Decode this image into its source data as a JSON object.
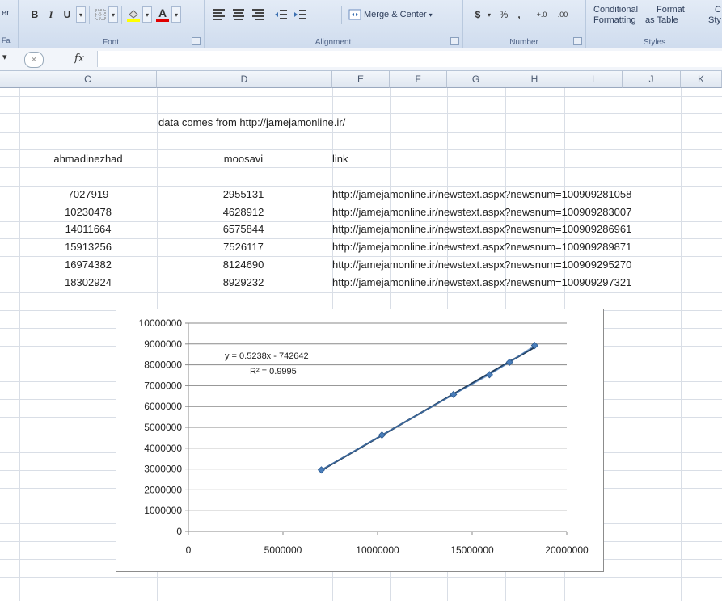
{
  "ribbon": {
    "font_group_label": "Font",
    "bold_label": "B",
    "italic_label": "I",
    "underline_label": "U",
    "font_color_label": "A",
    "alignment_group_label": "Alignment",
    "merge_center_label": "Merge & Center",
    "number_group_label": "Number",
    "currency_label": "$",
    "percent_label": "%",
    "comma_label": ",",
    "increase_decimal_label": "+.0",
    "decrease_decimal_label": ".00",
    "conditional_formatting_label_1": "Conditional",
    "conditional_formatting_label_2": "Formatting",
    "format_table_label_1": "Format",
    "format_table_label_2": "as Table",
    "cell_styles_label_1": "C",
    "cell_styles_label_2": "Sty",
    "styles_group_label": "Styles",
    "left_clip_1": "er",
    "left_clip_2": "Fa"
  },
  "formula_bar": {
    "fx_label": "fx"
  },
  "grid": {
    "columns": [
      "C",
      "D",
      "E",
      "F",
      "G",
      "H",
      "I",
      "J",
      "K"
    ],
    "source_note": "data comes from http://jamejamonline.ir/",
    "headers": {
      "c": "ahmadinezhad",
      "d": "moosavi",
      "e": "link"
    },
    "rows": [
      {
        "c": "7027919",
        "d": "2955131",
        "link": "http://jamejamonline.ir/newstext.aspx?newsnum=100909281058"
      },
      {
        "c": "10230478",
        "d": "4628912",
        "link": "http://jamejamonline.ir/newstext.aspx?newsnum=100909283007"
      },
      {
        "c": "14011664",
        "d": "6575844",
        "link": "http://jamejamonline.ir/newstext.aspx?newsnum=100909286961"
      },
      {
        "c": "15913256",
        "d": "7526117",
        "link": "http://jamejamonline.ir/newstext.aspx?newsnum=100909289871"
      },
      {
        "c": "16974382",
        "d": "8124690",
        "link": "http://jamejamonline.ir/newstext.aspx?newsnum=100909295270"
      },
      {
        "c": "18302924",
        "d": "8929232",
        "link": "http://jamejamonline.ir/newstext.aspx?newsnum=100909297321"
      }
    ]
  },
  "chart_data": {
    "type": "scatter",
    "x": [
      7027919,
      10230478,
      14011664,
      15913256,
      16974382,
      18302924
    ],
    "y": [
      2955131,
      4628912,
      6575844,
      7526117,
      8124690,
      8929232
    ],
    "xlim": [
      0,
      20000000
    ],
    "ylim": [
      0,
      10000000
    ],
    "x_ticks": [
      0,
      5000000,
      10000000,
      15000000,
      20000000
    ],
    "y_ticks": [
      0,
      1000000,
      2000000,
      3000000,
      4000000,
      5000000,
      6000000,
      7000000,
      8000000,
      9000000,
      10000000
    ],
    "grid": "horizontal",
    "trendline": {
      "slope": 0.5238,
      "intercept": -742642
    },
    "equation_label": "y = 0.5238x - 742642",
    "r2_label": "R² = 0.9995",
    "marker_color": "#4a7ebb",
    "line_color": "#1f3b5a"
  }
}
